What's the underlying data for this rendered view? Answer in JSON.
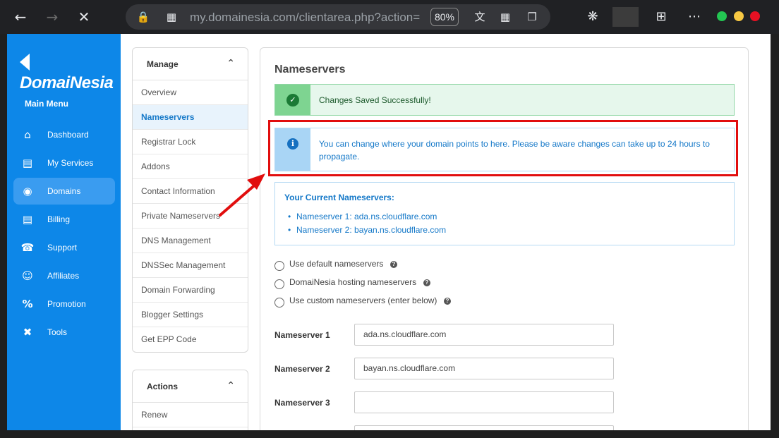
{
  "browser": {
    "url": "my.domainesia.com/clientarea.php?action=",
    "zoom": "80%",
    "colors": {
      "close": "#e81123",
      "minimize": "#23c552",
      "maximize": "#f7c843"
    }
  },
  "sidebar": {
    "logo": "DomaiNesia",
    "heading": "Main Menu",
    "items": [
      {
        "label": "Dashboard",
        "icon": "home-icon"
      },
      {
        "label": "My Services",
        "icon": "server-icon"
      },
      {
        "label": "Domains",
        "icon": "globe-icon",
        "active": true
      },
      {
        "label": "Billing",
        "icon": "receipt-icon"
      },
      {
        "label": "Support",
        "icon": "headset-icon"
      },
      {
        "label": "Affiliates",
        "icon": "users-icon"
      },
      {
        "label": "Promotion",
        "icon": "percent-icon"
      },
      {
        "label": "Tools",
        "icon": "tools-icon"
      }
    ]
  },
  "manage": {
    "title": "Manage",
    "items": [
      "Overview",
      "Nameservers",
      "Registrar Lock",
      "Addons",
      "Contact Information",
      "Private Nameservers",
      "DNS Management",
      "DNSSec Management",
      "Domain Forwarding",
      "Blogger Settings",
      "Get EPP Code"
    ],
    "active_index": 1
  },
  "actions": {
    "title": "Actions",
    "items": [
      "Renew"
    ]
  },
  "content": {
    "title": "Nameservers",
    "success_message": "Changes Saved Successfully!",
    "info_message": "You can change where your domain points to here. Please be aware changes can take up to 24 hours to propagate.",
    "current_heading": "Your Current Nameservers:",
    "current": [
      "Nameserver 1: ada.ns.cloudflare.com",
      "Nameserver 2: bayan.ns.cloudflare.com"
    ],
    "options": [
      "Use default nameservers",
      "DomaiNesia hosting nameservers",
      "Use custom nameservers (enter below)"
    ],
    "fields": [
      {
        "label": "Nameserver 1",
        "value": "ada.ns.cloudflare.com"
      },
      {
        "label": "Nameserver 2",
        "value": "bayan.ns.cloudflare.com"
      },
      {
        "label": "Nameserver 3",
        "value": ""
      }
    ]
  }
}
